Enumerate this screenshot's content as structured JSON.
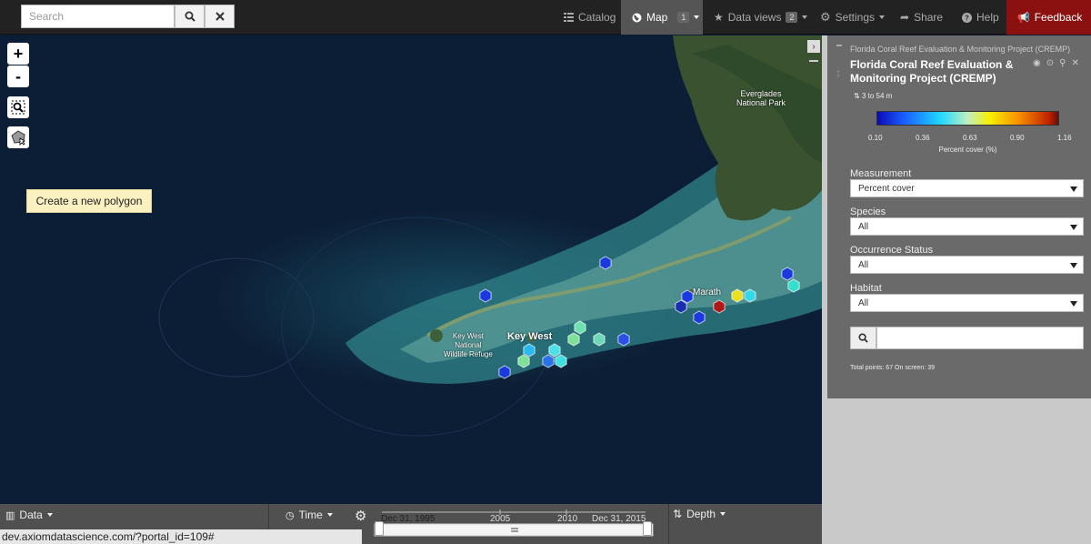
{
  "search": {
    "placeholder": "Search"
  },
  "nav": {
    "catalog": "Catalog",
    "map": "Map",
    "map_count": "1",
    "data_views": "Data views",
    "data_views_count": "2",
    "settings": "Settings",
    "share": "Share",
    "help": "Help",
    "feedback": "Feedback"
  },
  "map": {
    "zoom_in": "+",
    "zoom_out": "-",
    "tooltip": "Create a new polygon",
    "labels": {
      "everglades": "Everglades\nNational Park",
      "key_west": "Key West",
      "refuge": "Key West\nNational\nWildlife Refuge",
      "marathon": "Marath"
    }
  },
  "layer": {
    "breadcrumb": "Florida Coral Reef Evaluation & Monitoring Project (CREMP)",
    "title": "Florida Coral Reef Evaluation & Monitoring Project (CREMP)",
    "depth_range": "3 to 54 m",
    "legend": {
      "ticks": [
        "0.10",
        "0.36",
        "0.63",
        "0.90",
        "1.16"
      ],
      "label": "Percent cover (%)"
    },
    "filters": [
      {
        "label": "Measurement",
        "value": "Percent cover"
      },
      {
        "label": "Species",
        "value": "All"
      },
      {
        "label": "Occurrence Status",
        "value": "All"
      },
      {
        "label": "Habitat",
        "value": "All"
      }
    ],
    "totals": "Total points: 67 On screen: 39"
  },
  "bottom": {
    "data": "Data",
    "time": "Time",
    "depth": "Depth",
    "timeline": {
      "start": "Dec 31, 1995",
      "end": "Dec 31, 2015",
      "ticks": [
        "2005",
        "2010"
      ]
    }
  },
  "status_url": "dev.axiomdatascience.com/?portal_id=109#",
  "colors": {
    "navbar": "#222222",
    "feedback": "#8b1010",
    "panel": "#6a6a6a",
    "tooltip": "#fbf0c0"
  }
}
